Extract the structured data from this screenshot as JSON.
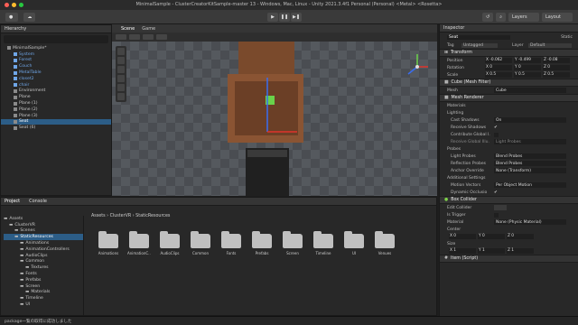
{
  "window": {
    "title": "MinimalSample - ClusterCreatorKitSample-master 13 - Windows, Mac, Linux - Unity 2021.3.4f1 Personal (Personal) <Metal> <Rosetta>"
  },
  "toolbar": {
    "account_label": "",
    "layers_label": "Layers",
    "layout_label": "Layout"
  },
  "hierarchy": {
    "tab": "Hierarchy",
    "rows": [
      {
        "label": "MinimalSample*",
        "indent": 1,
        "cls": ""
      },
      {
        "label": "System",
        "indent": 2,
        "cls": "blue"
      },
      {
        "label": "Forest",
        "indent": 2,
        "cls": "blue"
      },
      {
        "label": "Couch",
        "indent": 2,
        "cls": "blue"
      },
      {
        "label": "MetalTable",
        "indent": 2,
        "cls": "blue"
      },
      {
        "label": "closet2",
        "indent": 2,
        "cls": "blue"
      },
      {
        "label": "chair",
        "indent": 2,
        "cls": "blue"
      },
      {
        "label": "Environment",
        "indent": 2,
        "cls": ""
      },
      {
        "label": "Plane",
        "indent": 2,
        "cls": ""
      },
      {
        "label": "Plane (1)",
        "indent": 2,
        "cls": ""
      },
      {
        "label": "Plane (2)",
        "indent": 2,
        "cls": ""
      },
      {
        "label": "Plane (3)",
        "indent": 2,
        "cls": ""
      },
      {
        "label": "Seat",
        "indent": 2,
        "cls": "sel"
      },
      {
        "label": "Seat (6)",
        "indent": 2,
        "cls": ""
      }
    ]
  },
  "scene": {
    "tab_scene": "Scene",
    "tab_game": "Game"
  },
  "project": {
    "tab_project": "Project",
    "tab_console": "Console",
    "breadcrumb": "Assets › ClusterVR › StaticResources",
    "tree": [
      {
        "label": "Assets",
        "indent": 0
      },
      {
        "label": "ClusterVR",
        "indent": 1
      },
      {
        "label": "Scenes",
        "indent": 2
      },
      {
        "label": "StaticResources",
        "indent": 2,
        "sel": true
      },
      {
        "label": "Animations",
        "indent": 3
      },
      {
        "label": "AnimationControllers",
        "indent": 3
      },
      {
        "label": "AudioClips",
        "indent": 3
      },
      {
        "label": "Common",
        "indent": 3
      },
      {
        "label": "Textures",
        "indent": 4
      },
      {
        "label": "Fonts",
        "indent": 3
      },
      {
        "label": "Prefabs",
        "indent": 3
      },
      {
        "label": "Screen",
        "indent": 3
      },
      {
        "label": "Materials",
        "indent": 4
      },
      {
        "label": "Timeline",
        "indent": 3
      },
      {
        "label": "UI",
        "indent": 3
      }
    ],
    "folders": [
      "Animations",
      "AnimationC...",
      "AudioClips",
      "Common",
      "Fonts",
      "Prefabs",
      "Screen",
      "Timeline",
      "UI",
      "Venues"
    ]
  },
  "inspector": {
    "tab": "Inspector",
    "name": "Seat",
    "static": "Static",
    "tag_label": "Tag",
    "tag_value": "Untagged",
    "layer_label": "Layer",
    "layer_value": "Default",
    "transform": "Transform",
    "position": {
      "label": "Position",
      "x": "X -0.062",
      "y": "Y -0.499",
      "z": "Z -0.08"
    },
    "rotation": {
      "label": "Rotation",
      "x": "X 0",
      "y": "Y 0",
      "z": "Z 0"
    },
    "scale": {
      "label": "Scale",
      "x": "X 0.5",
      "y": "Y 0.5",
      "z": "Z 0.5"
    },
    "meshfilter": "Cube (Mesh Filter)",
    "mesh_label": "Mesh",
    "mesh_value": "Cube",
    "meshrenderer": "Mesh Renderer",
    "materials": "Materials",
    "lighting": "Lighting",
    "cast_label": "Cast Shadows",
    "cast_value": "On",
    "recv_label": "Receive Shadows",
    "gi_label": "Contribute Global I.",
    "recvgi_label": "Receive Global Illu.",
    "recvgi_value": "Light Probes",
    "probes": "Probes",
    "lightprobes_label": "Light Probes",
    "lightprobes_value": "Blend Probes",
    "reflprobes_label": "Reflection Probes",
    "reflprobes_value": "Blend Probes",
    "anchor_label": "Anchor Override",
    "anchor_value": "None (Transform)",
    "addl": "Additional Settings",
    "motion_label": "Motion Vectors",
    "motion_value": "Per Object Motion",
    "dyn_label": "Dynamic Occlusio",
    "boxcollider": "Box Collider",
    "edit_label": "Edit Collider",
    "trigger_label": "Is Trigger",
    "material_label": "Material",
    "material_value": "None (Physic Material)",
    "center_label": "Center",
    "center": {
      "x": "X 0",
      "y": "Y 0",
      "z": "Z 0"
    },
    "size_label": "Size",
    "size": {
      "x": "X 1",
      "y": "Y 1",
      "z": "Z 1"
    },
    "item": "Item (Script)"
  },
  "status": {
    "text": "package一覧の取得に成功しました"
  },
  "colors": {
    "accent": "#2c5d87",
    "bg": "#282828"
  }
}
